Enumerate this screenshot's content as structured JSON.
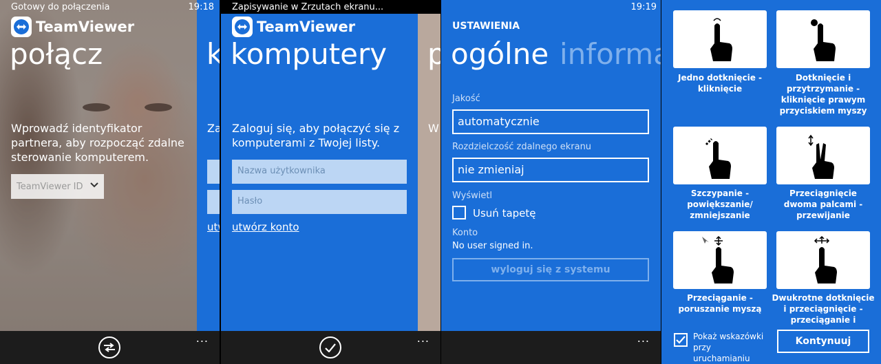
{
  "screen1": {
    "status": "Gotowy do połączenia",
    "clock": "19:18",
    "logo": "TeamViewer",
    "title": "połącz",
    "peek_title": "k",
    "instructions": "Wprowadź identyfikator partnera, aby rozpocząć zdalne sterowanie komputerem.",
    "id_placeholder": "TeamViewer ID",
    "peek_text": "Zalo",
    "peek_link": "utwo",
    "dots": "..."
  },
  "screen2": {
    "status": "Zapisywanie w Zrzutach ekranu...",
    "logo": "TeamViewer",
    "title": "komputery",
    "peek_title": "p",
    "instructions": "Zaloguj się, aby połączyć się z komputerami z Twojej listy.",
    "username_placeholder": "Nazwa użytkownika",
    "password_placeholder": "Hasło",
    "create_account": "utwórz konto",
    "peek_text": "W",
    "dots": "..."
  },
  "screen3": {
    "clock": "19:19",
    "header": "USTAWIENIA",
    "pivot_active": "ogólne",
    "pivot_next": "informa",
    "quality_label": "Jakość",
    "quality_value": "automatycznie",
    "resolution_label": "Rozdzielczość zdalnego ekranu",
    "resolution_value": "nie zmieniaj",
    "display_label": "Wyświetl",
    "remove_wallpaper": "Usuń tapetę",
    "account_label": "Konto",
    "account_value": "No user signed in.",
    "logout_button": "wyloguj się z systemu",
    "dots": "..."
  },
  "screen4": {
    "gestures": [
      {
        "label": "Jedno dotknięcie - kliknięcie",
        "icon": "single-tap-icon"
      },
      {
        "label": "Dotknięcie i przytrzymanie - kliknięcie prawym przyciskiem myszy",
        "icon": "tap-hold-icon"
      },
      {
        "label": "Szczypanie - powiększanie/ zmniejszanie",
        "icon": "pinch-icon"
      },
      {
        "label": "Przeciągnięcie dwoma palcami - przewijanie",
        "icon": "two-finger-drag-icon"
      },
      {
        "label": "Przeciąganie - poruszanie myszą",
        "icon": "drag-icon"
      },
      {
        "label": "Dwukrotne dotknięcie i przeciągnięcie - przeciąganie i",
        "icon": "double-tap-drag-icon"
      }
    ],
    "show_hints": "Pokaż wskazówki przy uruchamianiu",
    "continue_button": "Kontynuuj"
  },
  "colors": {
    "accent": "#1a6ed8",
    "appbar": "#1c1c1c",
    "input_bg": "#bcd6f4"
  }
}
